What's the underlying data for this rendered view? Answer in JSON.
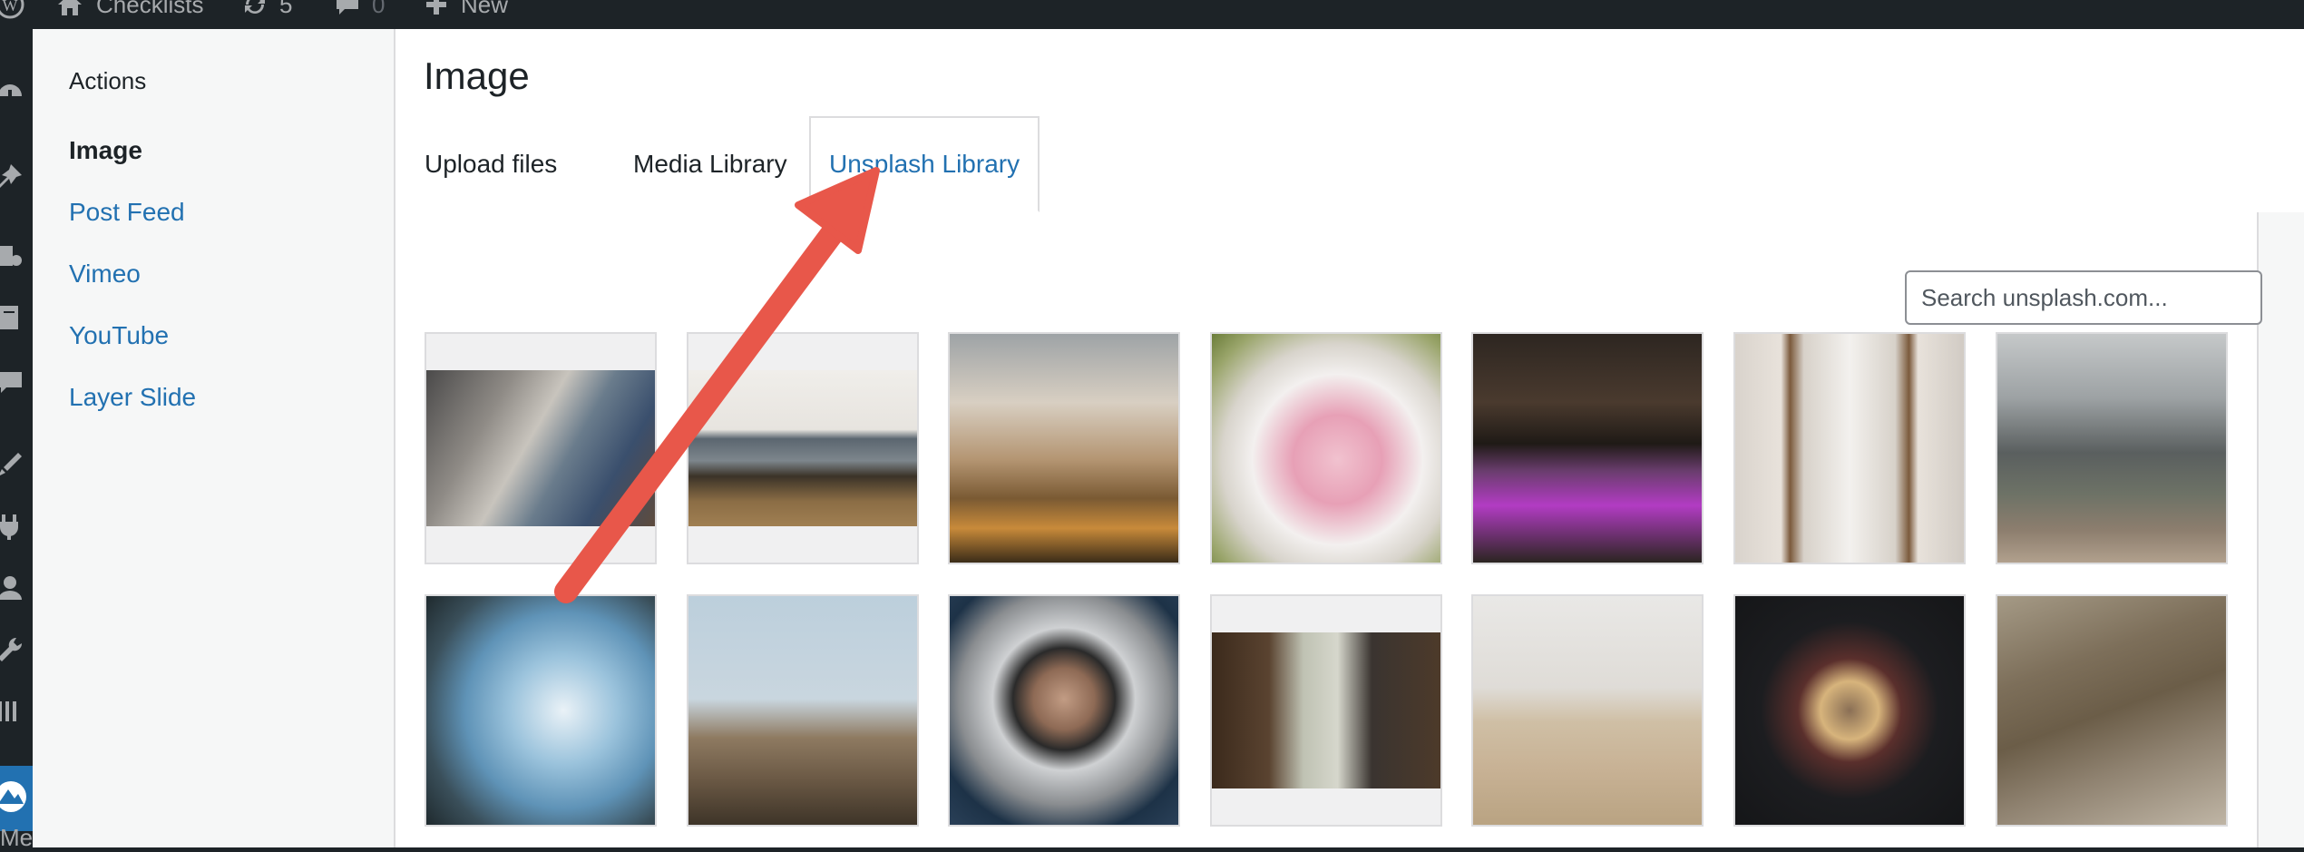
{
  "admin_bar": {
    "site_name": "Checklists",
    "updates_count": "5",
    "comments_count": "0",
    "new_label": "New"
  },
  "admin_menu": {
    "footer_text": "Me"
  },
  "media_menu": {
    "heading": "Actions",
    "items": [
      {
        "label": "Image"
      },
      {
        "label": "Post Feed"
      },
      {
        "label": "Vimeo"
      },
      {
        "label": "YouTube"
      },
      {
        "label": "Layer Slide"
      }
    ]
  },
  "frame": {
    "title": "Image"
  },
  "tabs": [
    {
      "label": "Upload files"
    },
    {
      "label": "Media Library"
    },
    {
      "label": "Unsplash Library"
    }
  ],
  "search": {
    "placeholder": "Search unsplash.com..."
  },
  "colors": {
    "accent": "#2271b1",
    "admin_bar": "#1d2327",
    "annotation_arrow": "#e8574a"
  }
}
